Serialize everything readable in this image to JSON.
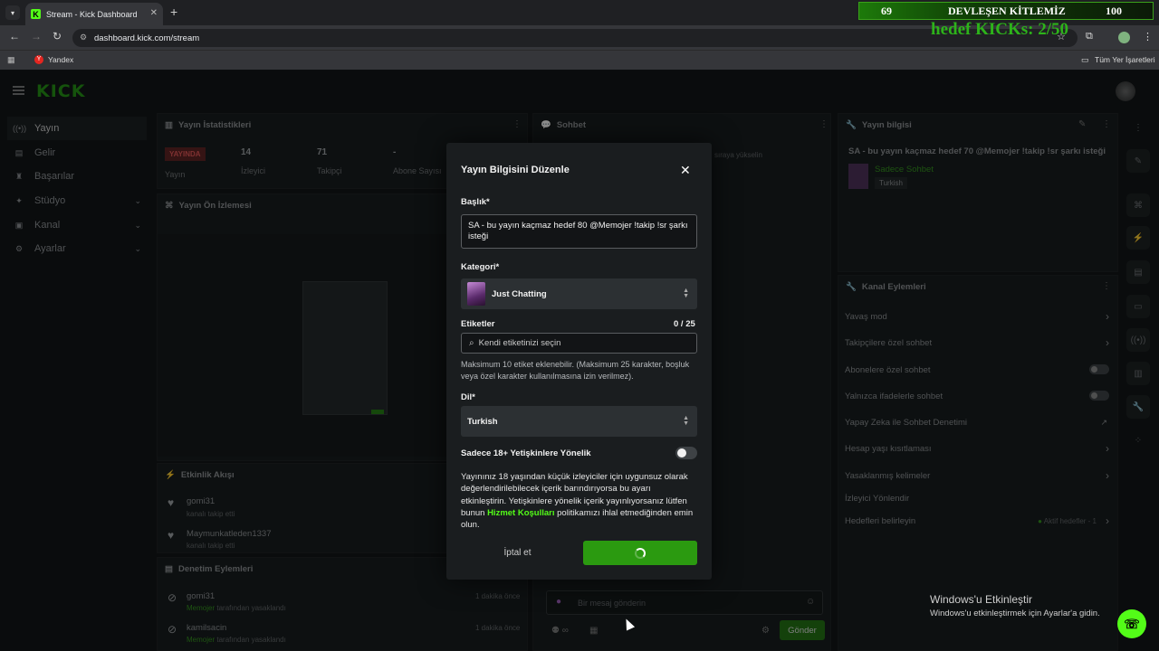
{
  "browser": {
    "tab_title": "Stream - Kick Dashboard",
    "url": "dashboard.kick.com/stream",
    "bookmark_1": "Yandex",
    "bookmarks_other": "Tüm Yer İşaretleri"
  },
  "overlay": {
    "left_count": "69",
    "title": "DEVLEŞEN KİTLEMİZ",
    "right_count": "100",
    "goal": "hedef KICKs: 2/50"
  },
  "sidebar": {
    "items": [
      {
        "label": "Yayın",
        "icon": "broadcast-icon"
      },
      {
        "label": "Gelir",
        "icon": "money-icon"
      },
      {
        "label": "Başarılar",
        "icon": "trophy-icon"
      },
      {
        "label": "Stüdyo",
        "icon": "studio-icon"
      },
      {
        "label": "Kanal",
        "icon": "channel-icon"
      },
      {
        "label": "Ayarlar",
        "icon": "gear-icon"
      }
    ]
  },
  "stats": {
    "title": "Yayın İstatistikleri",
    "live_badge": "YAYINDA",
    "live_label": "Yayın",
    "viewers": "14",
    "viewers_label": "İzleyici",
    "followers": "71",
    "followers_label": "Takipçi",
    "subs": "-",
    "subs_label": "Abone Sayısı"
  },
  "preview": {
    "title": "Yayın Ön İzlemesi"
  },
  "activity": {
    "title": "Etkinlik Akışı",
    "items": [
      {
        "user": "gomi31",
        "text": "kanalı takip etti"
      },
      {
        "user": "Maymunkatleden1337",
        "text": "kanalı takip etti"
      }
    ]
  },
  "moderation": {
    "title": "Denetim Eylemleri",
    "items": [
      {
        "user": "gomi31",
        "by": "Memojer",
        "text": "tarafından yasaklandı",
        "time": "1 dakika önce"
      },
      {
        "user": "kamilsacin",
        "by": "Memojer",
        "text": "tarafından yasaklandı",
        "time": "1 dakika önce"
      }
    ]
  },
  "chat": {
    "title": "Sohbet",
    "partial_text": "sıraya yükselin",
    "placeholder": "Bir mesaj gönderin",
    "send": "Gönder"
  },
  "stream_info": {
    "title": "Yayın bilgisi",
    "stream_title": "SA - bu yayın kaçmaz hedef 70 @Memojer !takip !sr şarkı isteği",
    "category": "Sadece Sohbet",
    "language": "Turkish"
  },
  "channel_actions": {
    "title": "Kanal Eylemleri",
    "items": [
      {
        "label": "Yavaş mod",
        "control": "chevron"
      },
      {
        "label": "Takipçilere özel sohbet",
        "control": "chevron"
      },
      {
        "label": "Abonelere özel sohbet",
        "control": "toggle"
      },
      {
        "label": "Yalnızca ifadelerle sohbet",
        "control": "toggle"
      },
      {
        "label": "Yapay Zeka ile Sohbet Denetimi",
        "control": "external"
      },
      {
        "label": "Hesap yaşı kısıtlaması",
        "control": "chevron"
      },
      {
        "label": "Yasaklanmış kelimeler",
        "control": "chevron"
      },
      {
        "label": "İzleyici Yönlendir",
        "control": "none"
      },
      {
        "label": "Hedefleri belirleyin",
        "control": "chevron"
      }
    ],
    "goal_status": "Aktif hedefler - 1"
  },
  "modal": {
    "title": "Yayın Bilgisini Düzenle",
    "title_label": "Başlık*",
    "title_value": "SA - bu yayın kaçmaz hedef 80 @Memojer !takip !sr şarkı isteği",
    "category_label": "Kategori*",
    "category_value": "Just Chatting",
    "tags_label": "Etiketler",
    "tags_count": "0 / 25",
    "tags_placeholder": "Kendi etiketinizi seçin",
    "tags_help": "Maksimum 10 etiket eklenebilir. (Maksimum 25 karakter, boşluk veya özel karakter kullanılmasına izin verilmez).",
    "language_label": "Dil*",
    "language_value": "Turkish",
    "adult_label": "Sadece 18+ Yetişkinlere Yönelik",
    "adult_info_1": "Yayınınız 18 yaşından küçük izleyiciler için uygunsuz olarak değerlendirilebilecek içerik barındırıyorsa bu ayarı etkinleştirin. Yetişkinlere yönelik içerik yayınlıyorsanız lütfen bunun ",
    "adult_info_link": "Hizmet Koşulları",
    "adult_info_2": " politikamızı ihlal etmediğinden emin olun.",
    "cancel": "İptal et"
  },
  "windows": {
    "activate_title": "Windows'u Etkinleştir",
    "activate_text": "Windows'u etkinleştirmek için Ayarlar'a gidin."
  }
}
